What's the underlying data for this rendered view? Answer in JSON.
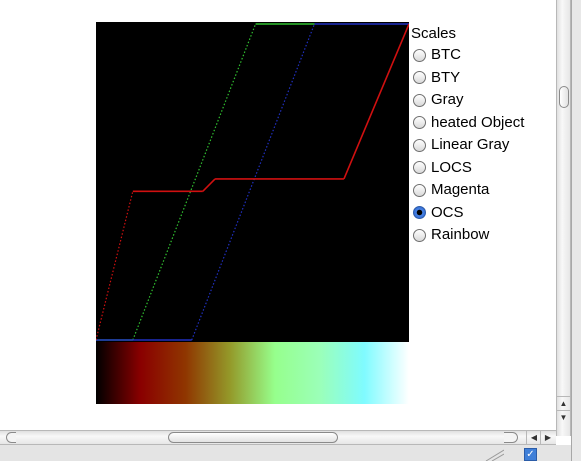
{
  "scales": {
    "title": "Scales",
    "items": [
      {
        "label": "BTC",
        "checked": false
      },
      {
        "label": "BTY",
        "checked": false
      },
      {
        "label": "Gray",
        "checked": false
      },
      {
        "label": "heated Object",
        "checked": false
      },
      {
        "label": "Linear Gray",
        "checked": false
      },
      {
        "label": "LOCS",
        "checked": false
      },
      {
        "label": "Magenta",
        "checked": false
      },
      {
        "label": "OCS",
        "checked": true
      },
      {
        "label": "Rainbow",
        "checked": false
      }
    ]
  },
  "selected_scale": "OCS",
  "curves": {
    "x_domain": [
      0,
      255
    ],
    "y_domain": [
      0,
      255
    ],
    "red": {
      "color": "#d01010",
      "style": "mixed",
      "points": [
        [
          0,
          0
        ],
        [
          30,
          120
        ],
        [
          87,
          120
        ],
        [
          97,
          130
        ],
        [
          202,
          130
        ],
        [
          255,
          255
        ]
      ]
    },
    "green": {
      "color": "#30c030",
      "style": "dotted",
      "points": [
        [
          0,
          0
        ],
        [
          30,
          0
        ],
        [
          130,
          255
        ],
        [
          178,
          255
        ]
      ]
    },
    "blue": {
      "color": "#2030c0",
      "style": "dotted",
      "points": [
        [
          0,
          0
        ],
        [
          78,
          0
        ],
        [
          178,
          255
        ],
        [
          255,
          255
        ]
      ]
    }
  },
  "colorbar": {
    "stops": [
      "#000000",
      "#8a0000",
      "#8f3600",
      "#949a2a",
      "#96ff8c",
      "#9bffb8",
      "#7ffbff",
      "#ffffff"
    ]
  },
  "status": {
    "text": ""
  },
  "scrollbars": {
    "vertical_position": 0.2,
    "horizontal_position": 0.3
  },
  "icons": {
    "scroll_up": "▲",
    "scroll_down": "▼",
    "scroll_left": "◀",
    "scroll_right": "▶",
    "checkbox": "✓"
  }
}
